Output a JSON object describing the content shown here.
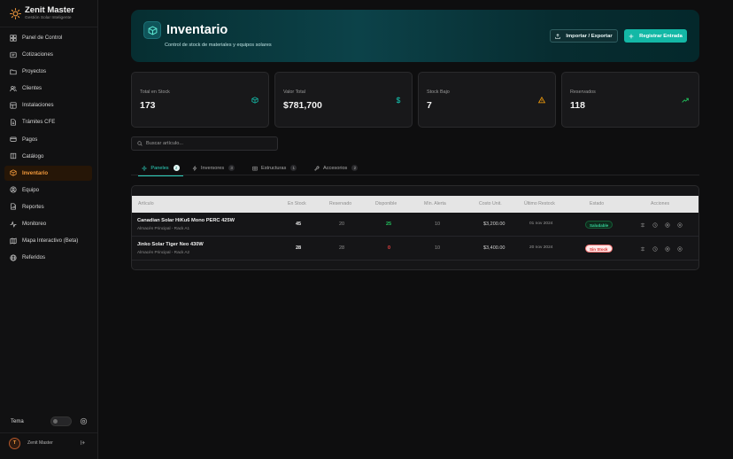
{
  "brand": {
    "name": "Zenit Master",
    "subtitle": "Gestión Solar Inteligente"
  },
  "nav": [
    {
      "label": "Panel de Control",
      "icon": "dashboard-icon"
    },
    {
      "label": "Cotizaciones",
      "icon": "quote-icon"
    },
    {
      "label": "Proyectos",
      "icon": "folder-icon"
    },
    {
      "label": "Clientes",
      "icon": "users-icon"
    },
    {
      "label": "Instalaciones",
      "icon": "installation-icon"
    },
    {
      "label": "Trámites CFE",
      "icon": "document-icon"
    },
    {
      "label": "Pagos",
      "icon": "wallet-icon"
    },
    {
      "label": "Catálogo",
      "icon": "catalog-icon"
    },
    {
      "label": "Inventario",
      "icon": "box-icon",
      "active": true
    },
    {
      "label": "Equipo",
      "icon": "team-icon"
    },
    {
      "label": "Reportes",
      "icon": "report-icon"
    },
    {
      "label": "Monitoreo",
      "icon": "activity-icon"
    },
    {
      "label": "Mapa Interactivo (Beta)",
      "icon": "map-icon"
    },
    {
      "label": "Referidos",
      "icon": "globe-icon"
    }
  ],
  "theme": {
    "label": "Tema"
  },
  "user": {
    "initial": "T",
    "name": "Zenit Master"
  },
  "header": {
    "title": "Inventario",
    "subtitle": "Control de stock de materiales y equipos solares",
    "import_export_label": "Importar / Exportar",
    "register_label": "Registrar Entrada"
  },
  "stats": [
    {
      "label": "Total en Stock",
      "value": "173",
      "icon": "box-icon",
      "color": "#14b8a6"
    },
    {
      "label": "Valor Total",
      "value": "$781,700",
      "icon": "dollar-icon",
      "color": "#14b8a6"
    },
    {
      "label": "Stock Bajo",
      "value": "7",
      "icon": "warning-icon",
      "color": "#f59e0b"
    },
    {
      "label": "Reservados",
      "value": "118",
      "icon": "trend-up-icon",
      "color": "#22c55e"
    }
  ],
  "search": {
    "placeholder": "Buscar artículo..."
  },
  "tabs": [
    {
      "label": "Paneles",
      "count": "2",
      "icon": "panel-icon",
      "active": true
    },
    {
      "label": "Inversores",
      "count": "3",
      "icon": "bolt-icon"
    },
    {
      "label": "Estructuras",
      "count": "1",
      "icon": "structure-icon"
    },
    {
      "label": "Accesorios",
      "count": "2",
      "icon": "tool-icon"
    }
  ],
  "table": {
    "columns": [
      "Artículo",
      "En Stock",
      "Reservado",
      "Disponible",
      "Mín. Alerta",
      "Costo Unit.",
      "Último Restock",
      "Estado",
      "Acciones"
    ],
    "rows": [
      {
        "name": "Canadian Solar HiKu6 Mono PERC 425W",
        "location": "Almacén Principal - Rack A1",
        "stock": "45",
        "reserved": "20",
        "available": "25",
        "min_alert": "10",
        "unit_cost": "$3,200.00",
        "restock": "01 nov 2024",
        "status": "Saludable",
        "status_type": "ok"
      },
      {
        "name": "Jinko Solar Tiger Neo 430W",
        "location": "Almacén Principal - Rack A2",
        "stock": "28",
        "reserved": "28",
        "available": "0",
        "min_alert": "10",
        "unit_cost": "$3,400.00",
        "restock": "20 nov 2024",
        "status": "Sin Stock",
        "status_type": "none"
      }
    ]
  },
  "colors": {
    "accent": "#14b8a6",
    "active_nav": "#f39a3c",
    "danger": "#ef4444",
    "success": "#22c55e"
  }
}
